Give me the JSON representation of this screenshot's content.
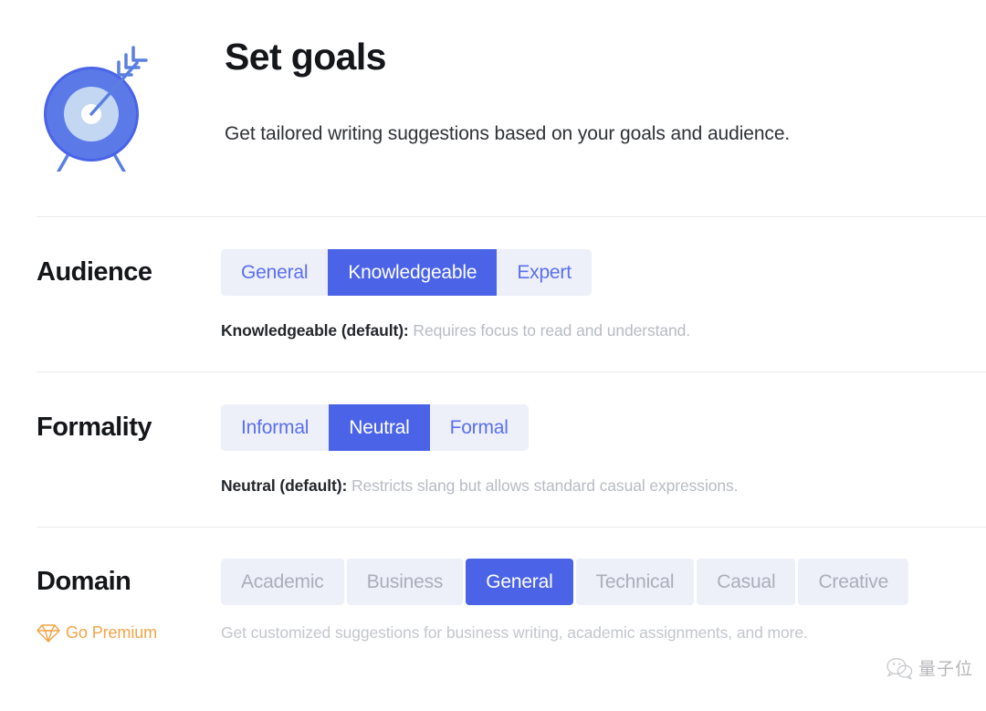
{
  "header": {
    "icon": "target-with-arrow-icon",
    "title": "Set goals",
    "subtitle": "Get tailored writing suggestions based on your goals and audience."
  },
  "colors": {
    "accent_blue": "#4a63e7",
    "segment_bg": "#eef0f9",
    "segment_text": "#5a6ff0",
    "disabled_text": "#a9aeb9",
    "muted_text": "#b7bbc3",
    "premium_gold": "#f0a447",
    "divider": "#e9eaee"
  },
  "settings": [
    {
      "id": "audience",
      "label": "Audience",
      "style": "joined",
      "options": [
        {
          "label": "General",
          "state": "normal"
        },
        {
          "label": "Knowledgeable",
          "state": "selected"
        },
        {
          "label": "Expert",
          "state": "normal"
        }
      ],
      "description_strong": "Knowledgeable (default):",
      "description_rest": " Requires focus to read and understand."
    },
    {
      "id": "formality",
      "label": "Formality",
      "style": "joined",
      "options": [
        {
          "label": "Informal",
          "state": "normal"
        },
        {
          "label": "Neutral",
          "state": "selected"
        },
        {
          "label": "Formal",
          "state": "normal"
        }
      ],
      "description_strong": "Neutral (default):",
      "description_rest": " Restricts slang but allows standard casual expressions."
    },
    {
      "id": "domain",
      "label": "Domain",
      "style": "spaced",
      "options": [
        {
          "label": "Academic",
          "state": "disabled"
        },
        {
          "label": "Business",
          "state": "disabled"
        },
        {
          "label": "General",
          "state": "selected"
        },
        {
          "label": "Technical",
          "state": "disabled"
        },
        {
          "label": "Casual",
          "state": "disabled"
        },
        {
          "label": "Creative",
          "state": "disabled"
        }
      ],
      "description_strong": "",
      "description_rest": ""
    }
  ],
  "premium": {
    "icon": "diamond-gem-icon",
    "label": "Go Premium",
    "description": "Get customized suggestions for business writing, academic assignments, and more."
  },
  "watermark": {
    "icon": "wechat-icon",
    "text": "量子位"
  }
}
